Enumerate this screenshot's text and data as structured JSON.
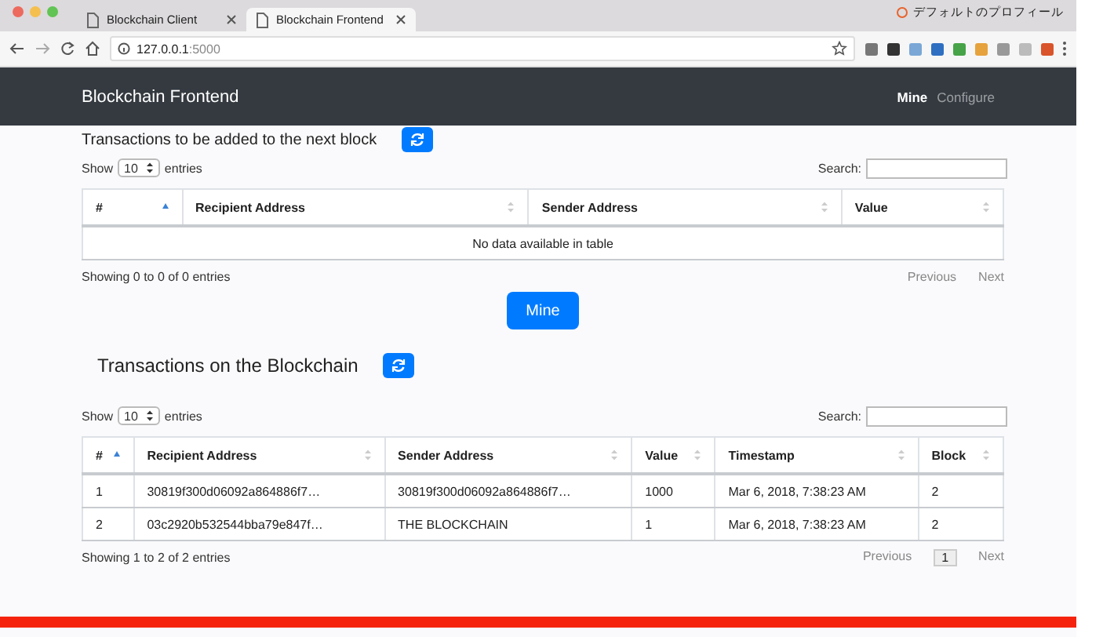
{
  "browser": {
    "tabs": [
      {
        "title": "Blockchain Client",
        "selected": false
      },
      {
        "title": "Blockchain Frontend",
        "selected": true
      }
    ],
    "profile": "デフォルトのプロフィール",
    "url_host": "127.0.0.1",
    "url_port": ":5000"
  },
  "navbar": {
    "brand": "Blockchain Frontend",
    "links": [
      {
        "label": "Mine",
        "selected": true
      },
      {
        "label": "Configure",
        "selected": false
      }
    ]
  },
  "pending": {
    "title": "Transactions to be added to the next block",
    "show_label": "Show",
    "page_size": "10",
    "entries_label": "entries",
    "search_label": "Search:",
    "columns": [
      {
        "label": "#",
        "sorted": true
      },
      {
        "label": "Recipient Address",
        "sorted": false
      },
      {
        "label": "Sender Address",
        "sorted": false
      },
      {
        "label": "Value",
        "sorted": false
      }
    ],
    "empty_message": "No data available in table",
    "info": "Showing 0 to 0 of 0 entries",
    "pagination": [
      {
        "label": "Previous",
        "selected": false
      },
      {
        "label": "Next",
        "selected": false
      }
    ]
  },
  "mine_button": "Mine",
  "chain": {
    "title": "Transactions on the Blockchain",
    "show_label": "Show",
    "page_size": "10",
    "entries_label": "entries",
    "search_label": "Search:",
    "columns": [
      {
        "label": "#",
        "sorted": true
      },
      {
        "label": "Recipient Address",
        "sorted": false
      },
      {
        "label": "Sender Address",
        "sorted": false
      },
      {
        "label": "Value",
        "sorted": false
      },
      {
        "label": "Timestamp",
        "sorted": false
      },
      {
        "label": "Block",
        "sorted": false
      }
    ],
    "rows": [
      [
        "1",
        "30819f300d06092a864886f7…",
        "30819f300d06092a864886f7…",
        "1000",
        "Mar 6, 2018, 7:38:23 AM",
        "2"
      ],
      [
        "2",
        "03c2920b532544bba79e847f…",
        "THE BLOCKCHAIN",
        "1",
        "Mar 6, 2018, 7:38:23 AM",
        "2"
      ]
    ],
    "info": "Showing 1 to 2 of 2 entries",
    "pagination": [
      {
        "label": "Previous",
        "selected": false
      },
      {
        "label": "1",
        "selected": true
      },
      {
        "label": "Next",
        "selected": false
      }
    ]
  }
}
